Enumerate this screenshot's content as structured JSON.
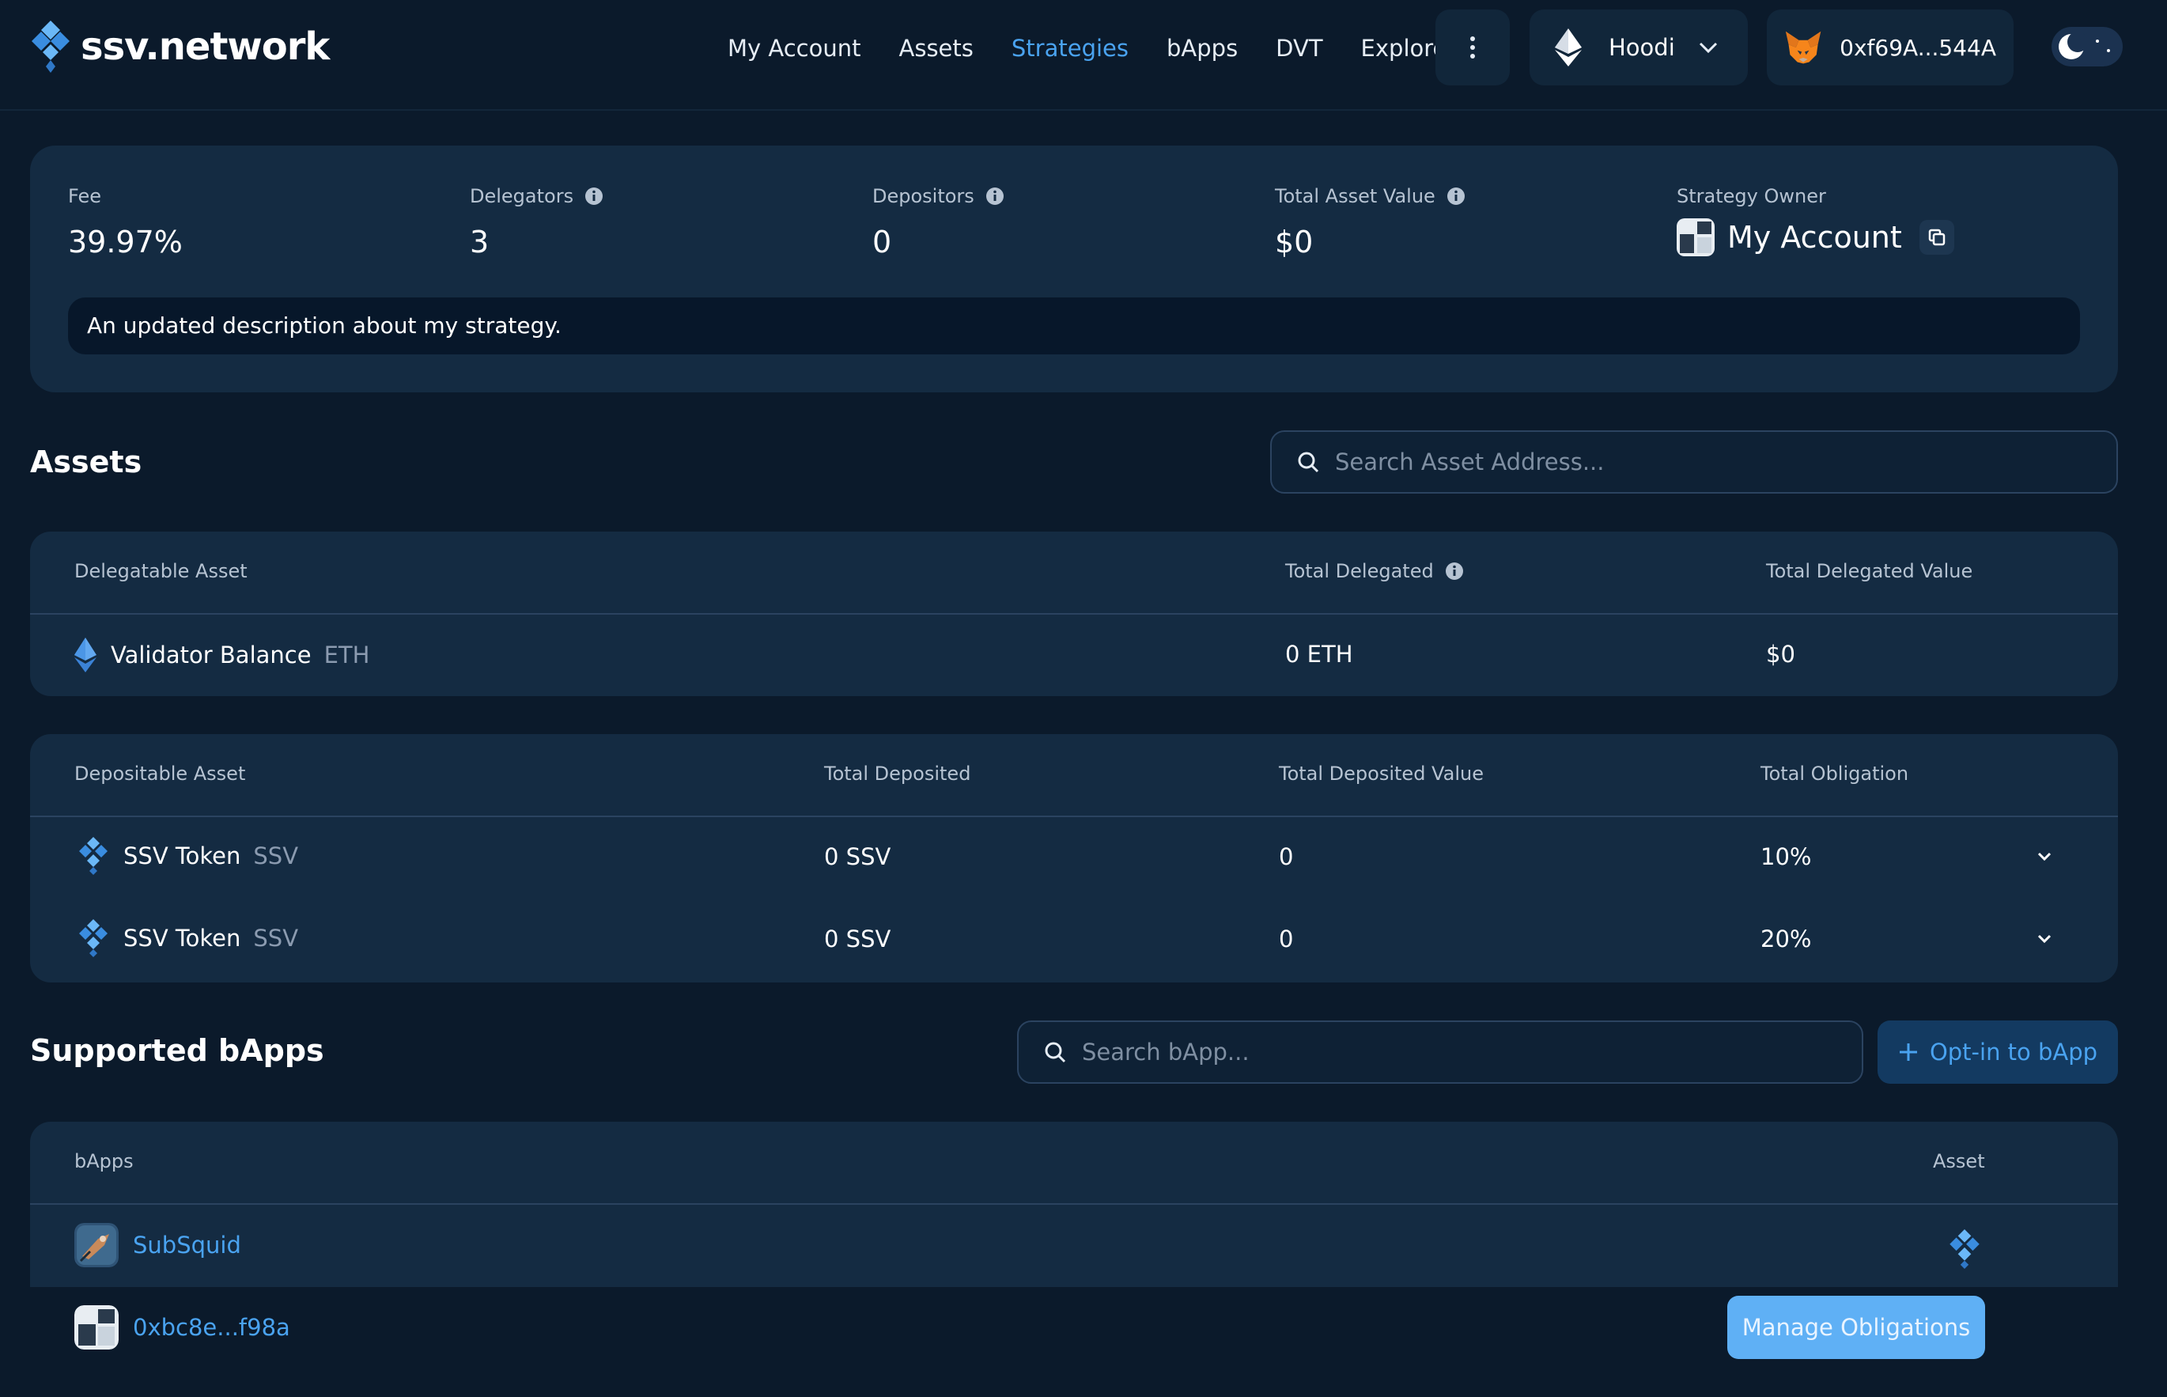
{
  "header": {
    "logo_text": "ssv.network",
    "nav": [
      "My Account",
      "Assets",
      "Strategies",
      "bApps",
      "DVT",
      "Explorer"
    ],
    "active_nav": "Strategies",
    "network": "Hoodi",
    "wallet": "0xf69A...544A"
  },
  "summary": {
    "fee_label": "Fee",
    "fee_value": "39.97%",
    "delegators_label": "Delegators",
    "delegators_value": "3",
    "depositors_label": "Depositors",
    "depositors_value": "0",
    "tav_label": "Total Asset Value",
    "tav_value": "$0",
    "owner_label": "Strategy Owner",
    "owner_value": "My Account",
    "description": "An updated description about my strategy."
  },
  "assets": {
    "title": "Assets",
    "search_placeholder": "Search Asset Address...",
    "delegatable": {
      "headers": [
        "Delegatable Asset",
        "Total Delegated",
        "Total Delegated Value"
      ],
      "rows": [
        {
          "name": "Validator Balance",
          "ticker": "ETH",
          "total": "0 ETH",
          "value": "$0"
        }
      ]
    },
    "depositable": {
      "headers": [
        "Depositable Asset",
        "Total Deposited",
        "Total Deposited Value",
        "Total Obligation"
      ],
      "rows": [
        {
          "name": "SSV Token",
          "ticker": "SSV",
          "total": "0 SSV",
          "value": "0",
          "obligation": "10%"
        },
        {
          "name": "SSV Token",
          "ticker": "SSV",
          "total": "0 SSV",
          "value": "0",
          "obligation": "20%"
        }
      ]
    }
  },
  "bapps": {
    "title": "Supported bApps",
    "search_placeholder": "Search bApp...",
    "optin_label": "Opt-in to bApp",
    "headers": [
      "bApps",
      "Asset"
    ],
    "rows": [
      {
        "name": "SubSquid"
      },
      {
        "name": "0xbc8e...f98a",
        "action": "Manage Obligations"
      }
    ]
  },
  "colors": {
    "background": "#0b1a2b",
    "card": "#142b42",
    "accent": "#4aa3f0",
    "manage_button": "#5fb0f5"
  }
}
